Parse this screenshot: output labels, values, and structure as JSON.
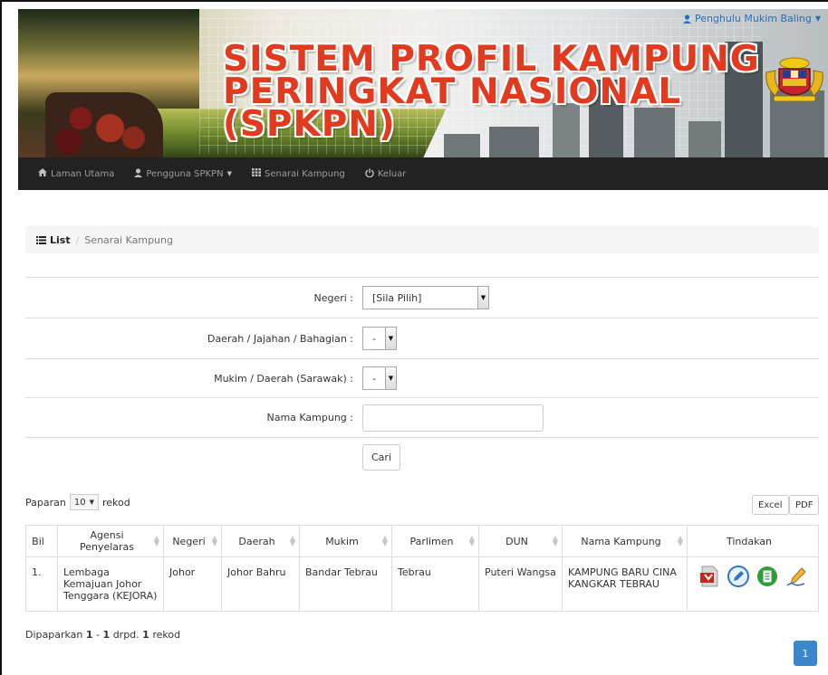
{
  "header": {
    "title_lines": [
      "SISTEM PROFIL KAMPUNG",
      "PERINGKAT NASIONAL",
      "(SPKPN)"
    ],
    "user_label": "Penghulu Mukim Baling"
  },
  "navbar": {
    "items": [
      {
        "label": "Laman Utama",
        "icon": "home-icon"
      },
      {
        "label": "Pengguna SPKPN",
        "icon": "user-icon",
        "dropdown": true
      },
      {
        "label": "Senarai Kampung",
        "icon": "grid-icon"
      },
      {
        "label": "Keluar",
        "icon": "power-icon"
      }
    ]
  },
  "breadcrumb": {
    "root": "List",
    "current": "Senarai Kampung"
  },
  "form": {
    "negeri_label": "Negeri :",
    "negeri_value": "[Sila Pilih]",
    "daerah_label": "Daerah / Jajahan / Bahagian :",
    "daerah_value": "-",
    "mukim_label": "Mukim / Daerah (Sarawak) :",
    "mukim_value": "-",
    "kampung_label": "Nama Kampung :",
    "kampung_value": "",
    "search_button": "Cari"
  },
  "table_controls": {
    "show_prefix": "Paparan",
    "show_value": "10",
    "show_suffix": "rekod",
    "excel_button": "Excel",
    "pdf_button": "PDF"
  },
  "table": {
    "columns": [
      "Bil",
      "Agensi Penyelaras",
      "Negeri",
      "Daerah",
      "Mukim",
      "Parlimen",
      "DUN",
      "Nama Kampung",
      "Tindakan"
    ],
    "rows": [
      {
        "bil": "1.",
        "agensi": "Lembaga Kemajuan Johor Tenggara (KEJORA)",
        "negeri": "Johor",
        "daerah": "Johor Bahru",
        "mukim": "Bandar Tebrau",
        "parlimen": "Tebrau",
        "dun": "Puteri Wangsa",
        "kampung": "KAMPUNG BARU CINA KANGKAR TEBRAU"
      }
    ]
  },
  "summary": {
    "prefix": "Dipaparkan",
    "from": "1",
    "dash": "-",
    "to": "1",
    "mid": "drpd.",
    "total": "1",
    "suffix": "rekod"
  },
  "pagination": {
    "current": "1"
  },
  "colors": {
    "navbar": "#222222",
    "title": "#e23a1e",
    "link": "#2a6ebb",
    "pager": "#3a87c9"
  }
}
